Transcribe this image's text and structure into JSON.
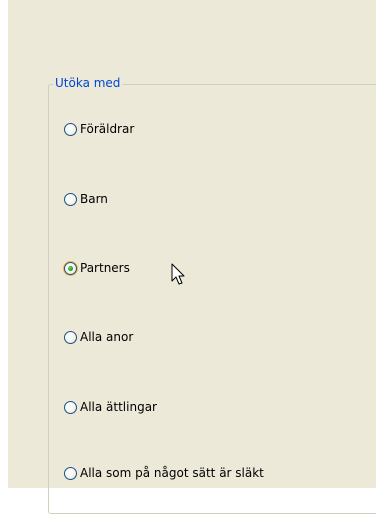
{
  "group": {
    "title": "Utöka med"
  },
  "options": [
    {
      "label": "Föräldrar",
      "checked": false
    },
    {
      "label": "Barn",
      "checked": false
    },
    {
      "label": "Partners",
      "checked": true
    },
    {
      "label": "Alla anor",
      "checked": false
    },
    {
      "label": "Alla ättlingar",
      "checked": false
    },
    {
      "label": "Alla som på något sätt är släkt",
      "checked": false
    }
  ],
  "colors": {
    "panel": "#ece9d8",
    "group_title": "#0046d5",
    "radio_border": "#1c5180",
    "radio_selected": "#21a121"
  },
  "icons": {
    "cursor": "arrow-cursor-icon"
  }
}
